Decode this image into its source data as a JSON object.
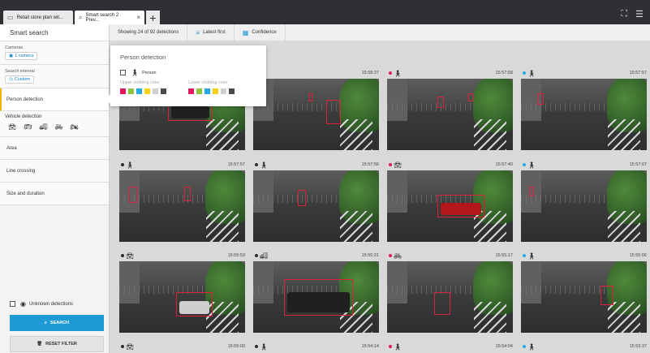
{
  "tabs": [
    {
      "label": "Retail store plan wit...",
      "icon": "monitor-icon",
      "active": false
    },
    {
      "label": "Smart search 2 Prev...",
      "icon": "search-icon",
      "active": true
    }
  ],
  "sidebar": {
    "title": "Smart search",
    "cameras": {
      "label": "Cameras",
      "value": "1 camera"
    },
    "interval": {
      "label": "Search interval",
      "value": "Custom"
    },
    "person_label": "Person detection",
    "vehicle_label": "Vehicle detection",
    "area_label": "Area",
    "line_label": "Line crossing",
    "size_label": "Size and duration",
    "unknown_label": "Unknown detections",
    "search_button": "SEARCH",
    "reset_button": "RESET FILTER"
  },
  "toolbar": {
    "count": "Showing 24 of 92 detections",
    "sort": "Latest first",
    "confidence": "Confidence"
  },
  "popover": {
    "title": "Person detection",
    "person_label": "Person",
    "upper_label": "Upper clothing color",
    "lower_label": "Lower clothing color",
    "colors": [
      "#e2195c",
      "#8cc63f",
      "#27aae1",
      "#f7d117",
      "#cfcfcf",
      "#4a4a4a"
    ]
  },
  "tiles": [
    {
      "time": "",
      "icons": [
        "person"
      ]
    },
    {
      "time": "15:58:37",
      "icons": [
        "person"
      ]
    },
    {
      "time": "15:57:58",
      "icons": [
        "person"
      ]
    },
    {
      "time": "15:57:57",
      "icons": [
        "person"
      ]
    },
    {
      "time": "15:57:57",
      "icons": [
        "person"
      ]
    },
    {
      "time": "15:57:56",
      "icons": [
        "person"
      ]
    },
    {
      "time": "15:57:40",
      "icons": [
        "car"
      ]
    },
    {
      "time": "15:57:07",
      "icons": [
        "person"
      ]
    },
    {
      "time": "15:55:53",
      "icons": [
        "car"
      ]
    },
    {
      "time": "15:55:21",
      "icons": [
        "truck"
      ]
    },
    {
      "time": "15:55:17",
      "icons": [
        "bike"
      ]
    },
    {
      "time": "15:55:06",
      "icons": [
        "person"
      ]
    },
    {
      "time": "15:55:00",
      "icons": [
        "car"
      ]
    },
    {
      "time": "15:54:14",
      "icons": [
        "person"
      ]
    },
    {
      "time": "15:54:04",
      "icons": [
        "person"
      ]
    },
    {
      "time": "15:53:37",
      "icons": [
        "person"
      ]
    }
  ]
}
